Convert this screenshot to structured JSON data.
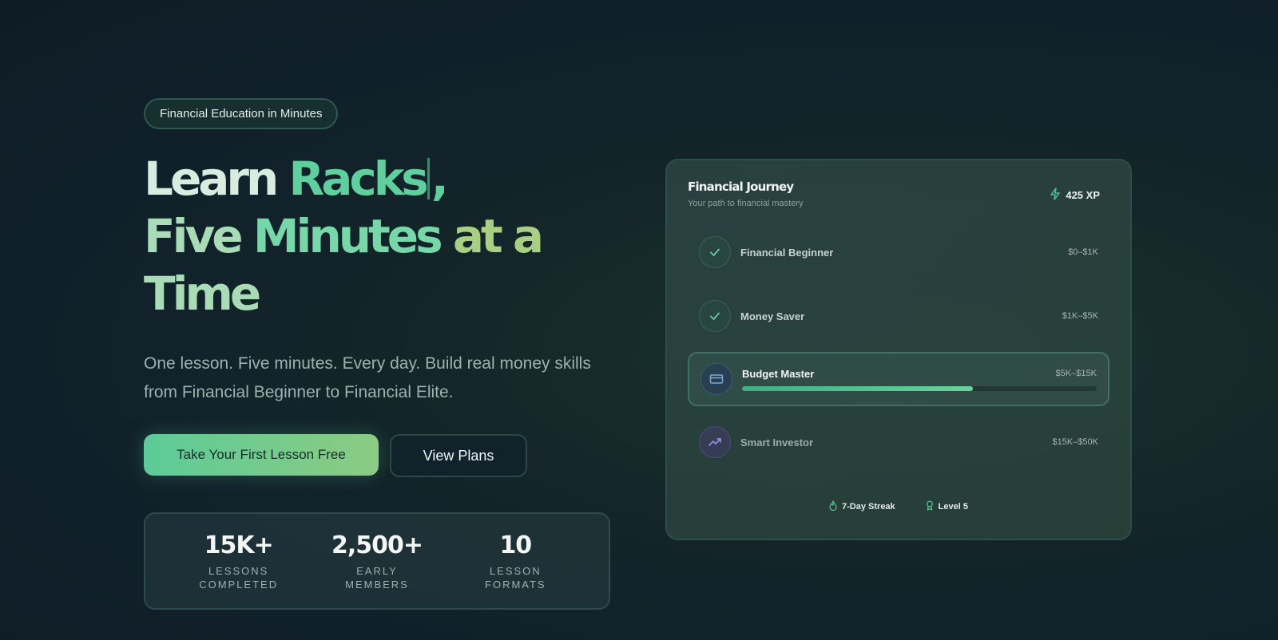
{
  "hero": {
    "badge": "Financial Education in Minutes",
    "headline": {
      "w1": "Learn ",
      "w2": "Racks",
      "w2_suffix": ",",
      "w3": "Five ",
      "w4": "Minutes ",
      "w5": "at a",
      "w6": "Time"
    },
    "subtitle": "One lesson. Five minutes. Every day. Build real money skills from Financial Beginner to Financial Elite.",
    "primary_cta": "Take Your First Lesson Free",
    "secondary_cta": "View Plans"
  },
  "stats": [
    {
      "value": "15K+",
      "label_l1": "LESSONS",
      "label_l2": "COMPLETED"
    },
    {
      "value": "2,500+",
      "label_l1": "EARLY",
      "label_l2": "MEMBERS"
    },
    {
      "value": "10",
      "label_l1": "LESSON",
      "label_l2": "FORMATS"
    }
  ],
  "journey": {
    "title": "Financial Journey",
    "subtitle": "Your path to financial mastery",
    "xp": "425 XP",
    "levels": [
      {
        "name": "Financial Beginner",
        "range": "$0–$1K",
        "status": "completed",
        "icon": "check-icon"
      },
      {
        "name": "Money Saver",
        "range": "$1K–$5K",
        "status": "completed",
        "icon": "check-icon"
      },
      {
        "name": "Budget Master",
        "range": "$5K–$15K",
        "status": "active",
        "icon": "credit-card-icon",
        "progress": 0.65
      },
      {
        "name": "Smart Investor",
        "range": "$15K–$50K",
        "status": "locked",
        "icon": "trending-up-icon"
      }
    ],
    "streak": "7-Day Streak",
    "level": "Level 5"
  },
  "colors": {
    "accent": "#5fcf9e",
    "background": "#10202a"
  }
}
